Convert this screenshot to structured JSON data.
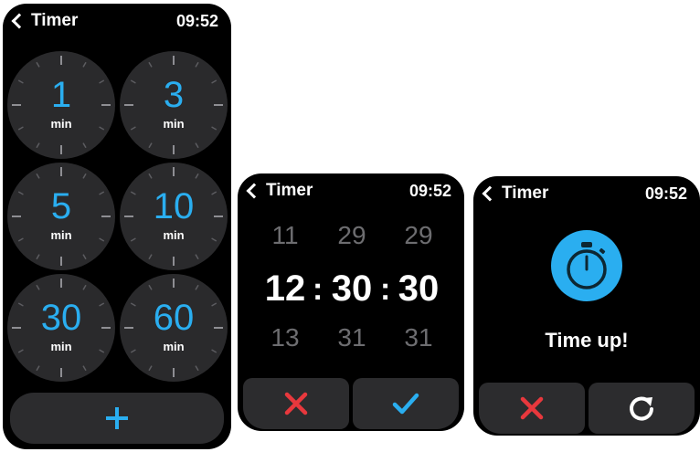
{
  "timer_list": {
    "title": "Timer",
    "time": "09:52",
    "presets": [
      {
        "value": "1",
        "unit": "min"
      },
      {
        "value": "3",
        "unit": "min"
      },
      {
        "value": "5",
        "unit": "min"
      },
      {
        "value": "10",
        "unit": "min"
      },
      {
        "value": "30",
        "unit": "min"
      },
      {
        "value": "60",
        "unit": "min"
      }
    ],
    "add_icon": "plus-icon"
  },
  "time_picker": {
    "title": "Timer",
    "time": "09:52",
    "hours": {
      "above": "11",
      "selected": "12",
      "below": "13"
    },
    "minutes": {
      "above": "29",
      "selected": "30",
      "below": "31"
    },
    "seconds": {
      "above": "29",
      "selected": "30",
      "below": "31"
    },
    "separator": ":",
    "cancel_icon": "close-icon",
    "confirm_icon": "check-icon"
  },
  "time_up": {
    "title": "Timer",
    "time": "09:52",
    "message": "Time up!",
    "alert_icon": "stopwatch-icon",
    "cancel_icon": "close-icon",
    "restart_icon": "restart-icon"
  },
  "colors": {
    "accent": "#2aaef0",
    "cancel": "#e8383d",
    "panel": "#2c2c2e"
  }
}
